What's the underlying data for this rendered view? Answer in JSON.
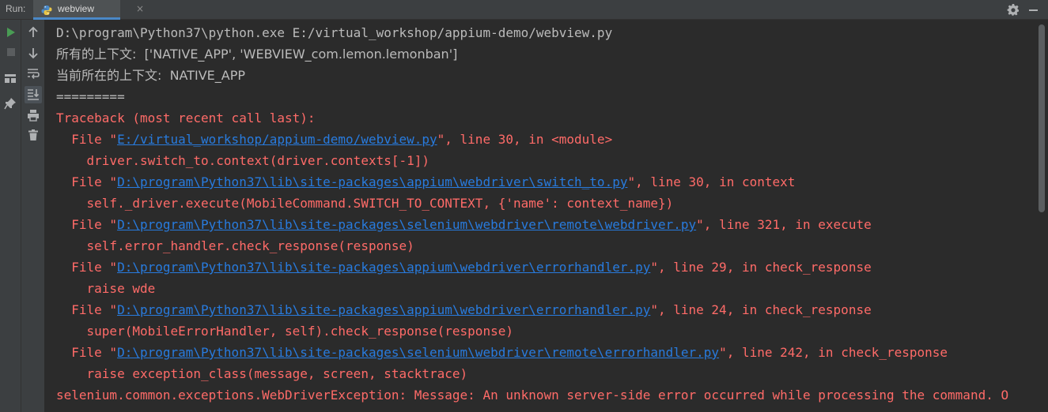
{
  "toolbar": {
    "run_label": "Run:",
    "tab_title": "webview",
    "tab_icon": "python-icon",
    "close_symbol": "×"
  },
  "colors": {
    "background": "#2b2b2b",
    "panel": "#3c3f41",
    "text": "#bbbbbb",
    "error": "#ff6b68",
    "link": "#287bde",
    "run_green": "#499c54"
  },
  "console": {
    "lines": [
      {
        "text": "D:\\program\\Python37\\python.exe E:/virtual_workshop/appium-demo/webview.py"
      },
      {
        "text": "所有的上下文:  ['NATIVE_APP', 'WEBVIEW_com.lemon.lemonban']"
      },
      {
        "text": "当前所在的上下文:  NATIVE_APP"
      },
      {
        "text": "========="
      },
      {
        "text": "Traceback (most recent call last):"
      },
      {
        "pre": "  File \"",
        "link": "E:/virtual_workshop/appium-demo/webview.py",
        "post": "\", line 30, in <module>"
      },
      {
        "text": "    driver.switch_to.context(driver.contexts[-1])"
      },
      {
        "pre": "  File \"",
        "link": "D:\\program\\Python37\\lib\\site-packages\\appium\\webdriver\\switch_to.py",
        "post": "\", line 30, in context"
      },
      {
        "text": "    self._driver.execute(MobileCommand.SWITCH_TO_CONTEXT, {'name': context_name})"
      },
      {
        "pre": "  File \"",
        "link": "D:\\program\\Python37\\lib\\site-packages\\selenium\\webdriver\\remote\\webdriver.py",
        "post": "\", line 321, in execute"
      },
      {
        "text": "    self.error_handler.check_response(response)"
      },
      {
        "pre": "  File \"",
        "link": "D:\\program\\Python37\\lib\\site-packages\\appium\\webdriver\\errorhandler.py",
        "post": "\", line 29, in check_response"
      },
      {
        "text": "    raise wde"
      },
      {
        "pre": "  File \"",
        "link": "D:\\program\\Python37\\lib\\site-packages\\appium\\webdriver\\errorhandler.py",
        "post": "\", line 24, in check_response"
      },
      {
        "text": "    super(MobileErrorHandler, self).check_response(response)"
      },
      {
        "pre": "  File \"",
        "link": "D:\\program\\Python37\\lib\\site-packages\\selenium\\webdriver\\remote\\errorhandler.py",
        "post": "\", line 242, in check_response"
      },
      {
        "text": "    raise exception_class(message, screen, stacktrace)"
      },
      {
        "text": "selenium.common.exceptions.WebDriverException: Message: An unknown server-side error occurred while processing the command. O"
      }
    ]
  }
}
